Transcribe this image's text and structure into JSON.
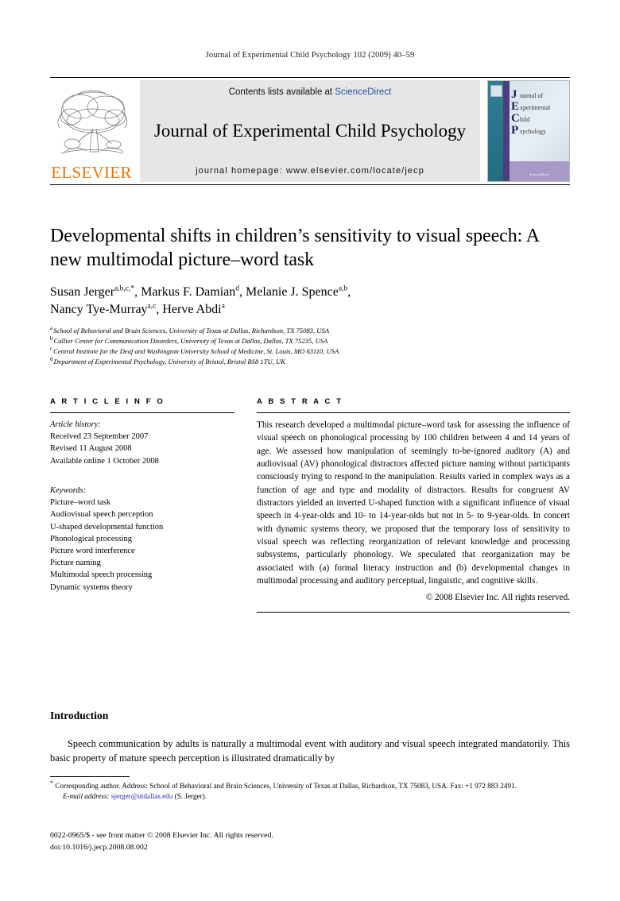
{
  "running_head": "Journal of Experimental Child Psychology 102 (2009) 40–59",
  "masthead": {
    "publisher_logo_text": "ELSEVIER",
    "contents_prefix": "Contents lists available at ",
    "contents_link": "ScienceDirect",
    "journal_title": "Journal of Experimental Child Psychology",
    "homepage_line": "journal homepage: www.elsevier.com/locate/jecp",
    "cover": {
      "lines": [
        {
          "cap": "J",
          "rest": "ournal of"
        },
        {
          "cap": "E",
          "rest": "xperimental"
        },
        {
          "cap": "C",
          "rest": "hild"
        },
        {
          "cap": "P",
          "rest": "sychology"
        }
      ],
      "bottom_logo": "ScienceDirect"
    },
    "colors": {
      "link_blue": "#2a4fa2",
      "elsevier_orange": "#ec7404",
      "box_grey": "#e6e6e6"
    }
  },
  "article": {
    "title": "Developmental shifts in children’s sensitivity to visual speech: A new multimodal picture–word task",
    "authors_line_1": "Susan Jerger",
    "authors": [
      {
        "name": "Susan Jerger",
        "sup": "a,b,c,*"
      },
      {
        "name": "Markus F. Damian",
        "sup": "d"
      },
      {
        "name": "Melanie J. Spence",
        "sup": "a,b"
      },
      {
        "name": "Nancy Tye-Murray",
        "sup": "a,c"
      },
      {
        "name": "Herve Abdi",
        "sup": "a"
      }
    ],
    "affiliations": [
      {
        "mark": "a",
        "text": "School of Behavioral and Brain Sciences, University of Texas at Dallas, Richardson, TX 75083, USA"
      },
      {
        "mark": "b",
        "text": "Callier Center for Communication Disorders, University of Texas at Dallas, Dallas, TX 75235, USA"
      },
      {
        "mark": "c",
        "text": "Central Institute for the Deaf and Washington University School of Medicine, St. Louis, MO 63110, USA"
      },
      {
        "mark": "d",
        "text": "Department of Experimental Psychology, University of Bristol, Bristol BS8 1TU, UK"
      }
    ]
  },
  "article_info": {
    "heading": "A R T I C L E    I N F O",
    "history_label": "Article history:",
    "history": [
      "Received 23 September 2007",
      "Revised 11 August 2008",
      "Available online 1 October 2008"
    ],
    "keywords_label": "Keywords:",
    "keywords": [
      "Picture–word task",
      "Audiovisual speech perception",
      "U-shaped developmental function",
      "Phonological processing",
      "Picture word interference",
      "Picture naming",
      "Multimodal speech processing",
      "Dynamic systems theory"
    ]
  },
  "abstract": {
    "heading": "A B S T R A C T",
    "text": "This research developed a multimodal picture–word task for assessing the influence of visual speech on phonological processing by 100 children between 4 and 14 years of age. We assessed how manipulation of seemingly to-be-ignored auditory (A) and audiovisual (AV) phonological distractors affected picture naming without participants consciously trying to respond to the manipulation. Results varied in complex ways as a function of age and type and modality of distractors. Results for congruent AV distractors yielded an inverted U-shaped function with a significant influence of visual speech in 4-year-olds and 10- to 14-year-olds but not in 5- to 9-year-olds. In concert with dynamic systems theory, we proposed that the temporary loss of sensitivity to visual speech was reflecting reorganization of relevant knowledge and processing subsystems, particularly phonology. We speculated that reorganization may be associated with (a) formal literacy instruction and (b) developmental changes in multimodal processing and auditory perceptual, linguistic, and cognitive skills.",
    "copyright": "© 2008 Elsevier Inc. All rights reserved."
  },
  "body": {
    "section_heading": "Introduction",
    "first_paragraph": "Speech communication by adults is naturally a multimodal event with auditory and visual speech integrated mandatorily. This basic property of mature speech perception is illustrated dramatically by"
  },
  "footnotes": {
    "corresponding_mark": "*",
    "corresponding_text": "Corresponding author. Address: School of Behavioral and Brain Sciences, University of Texas at Dallas, Richardson, TX 75083, USA. Fax: +1 972 883 2491.",
    "email_label": "E-mail address:",
    "email": "sjerger@utdallas.edu",
    "email_suffix": "(S. Jerger)."
  },
  "front_matter": {
    "issn_line": "0022-0965/$ - see front matter © 2008 Elsevier Inc. All rights reserved.",
    "doi_line": "doi:10.1016/j.jecp.2008.08.002"
  }
}
